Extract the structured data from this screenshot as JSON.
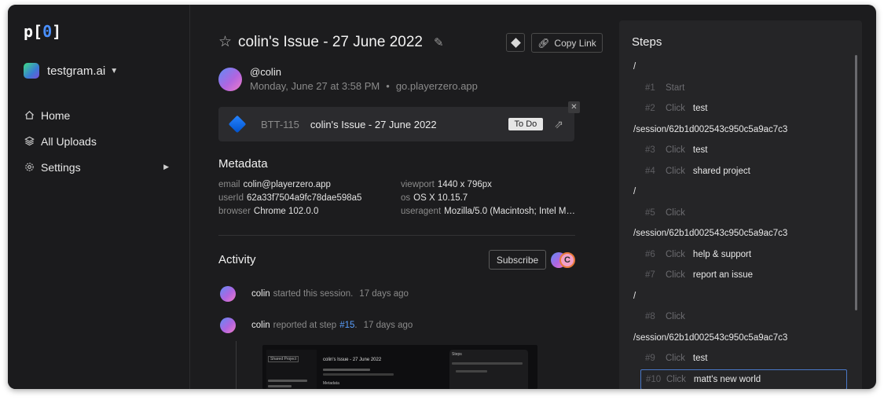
{
  "app": {
    "logo_p": "p",
    "logo_bracket_open": "[",
    "logo_zero": "0",
    "logo_bracket_close": "]"
  },
  "sidebar": {
    "org_name": "testgram.ai",
    "items": [
      {
        "label": "Home",
        "icon": "home-icon"
      },
      {
        "label": "All Uploads",
        "icon": "layers-icon"
      },
      {
        "label": "Settings",
        "icon": "gear-icon"
      }
    ]
  },
  "issue": {
    "title": "colin's Issue - 27 June 2022",
    "copy_link_label": "Copy Link",
    "author_handle": "@colin",
    "date": "Monday, June 27 at 3:58 PM",
    "source": "go.playerzero.app",
    "ticket": {
      "key": "BTT-115",
      "title": "colin's Issue - 27 June 2022",
      "status": "To Do"
    }
  },
  "metadata": {
    "heading": "Metadata",
    "rows": [
      {
        "key": "email",
        "value": "colin@playerzero.app"
      },
      {
        "key": "viewport",
        "value": "1440 x 796px"
      },
      {
        "key": "userId",
        "value": "62a33f7504a9fc78dae598a5"
      },
      {
        "key": "os",
        "value": "OS X 10.15.7"
      },
      {
        "key": "browser",
        "value": "Chrome 102.0.0"
      },
      {
        "key": "useragent",
        "value": "Mozilla/5.0 (Macintosh; Intel Ma…"
      }
    ]
  },
  "activity": {
    "heading": "Activity",
    "subscribe_label": "Subscribe",
    "subscriber_initial": "C",
    "events": [
      {
        "who": "colin",
        "what": "started this session.",
        "link": "",
        "when": "17 days ago"
      },
      {
        "who": "colin",
        "what": "reported at step",
        "link": "#15",
        "when": "17 days ago"
      }
    ],
    "thumbnail": {
      "title": "colin's Issue - 27 June 2022",
      "steps_label": "Steps",
      "metadata_label": "Metadata",
      "shared_project": "Shared Project"
    }
  },
  "steps": {
    "heading": "Steps",
    "entries": [
      {
        "type": "path",
        "text": "/"
      },
      {
        "type": "step",
        "num": "#1",
        "action": "Start",
        "label": ""
      },
      {
        "type": "step",
        "num": "#2",
        "action": "Click",
        "label": "test"
      },
      {
        "type": "path",
        "text": "/session/62b1d002543c950c5a9ac7c3"
      },
      {
        "type": "step",
        "num": "#3",
        "action": "Click",
        "label": "test"
      },
      {
        "type": "step",
        "num": "#4",
        "action": "Click",
        "label": "shared project"
      },
      {
        "type": "path",
        "text": "/"
      },
      {
        "type": "step",
        "num": "#5",
        "action": "Click",
        "label": ""
      },
      {
        "type": "path",
        "text": "/session/62b1d002543c950c5a9ac7c3"
      },
      {
        "type": "step",
        "num": "#6",
        "action": "Click",
        "label": "help & support"
      },
      {
        "type": "step",
        "num": "#7",
        "action": "Click",
        "label": "report an issue"
      },
      {
        "type": "path",
        "text": "/"
      },
      {
        "type": "step",
        "num": "#8",
        "action": "Click",
        "label": ""
      },
      {
        "type": "path",
        "text": "/session/62b1d002543c950c5a9ac7c3"
      },
      {
        "type": "step",
        "num": "#9",
        "action": "Click",
        "label": "test"
      },
      {
        "type": "step",
        "num": "#10",
        "action": "Click",
        "label": "matt's new world",
        "active": true
      }
    ]
  },
  "colors": {
    "background": "#1c1c1e",
    "panel": "#252527",
    "accent_link": "#5aa0ff",
    "active_step_border": "#4a78c8",
    "jira_blue": "#2684ff"
  }
}
